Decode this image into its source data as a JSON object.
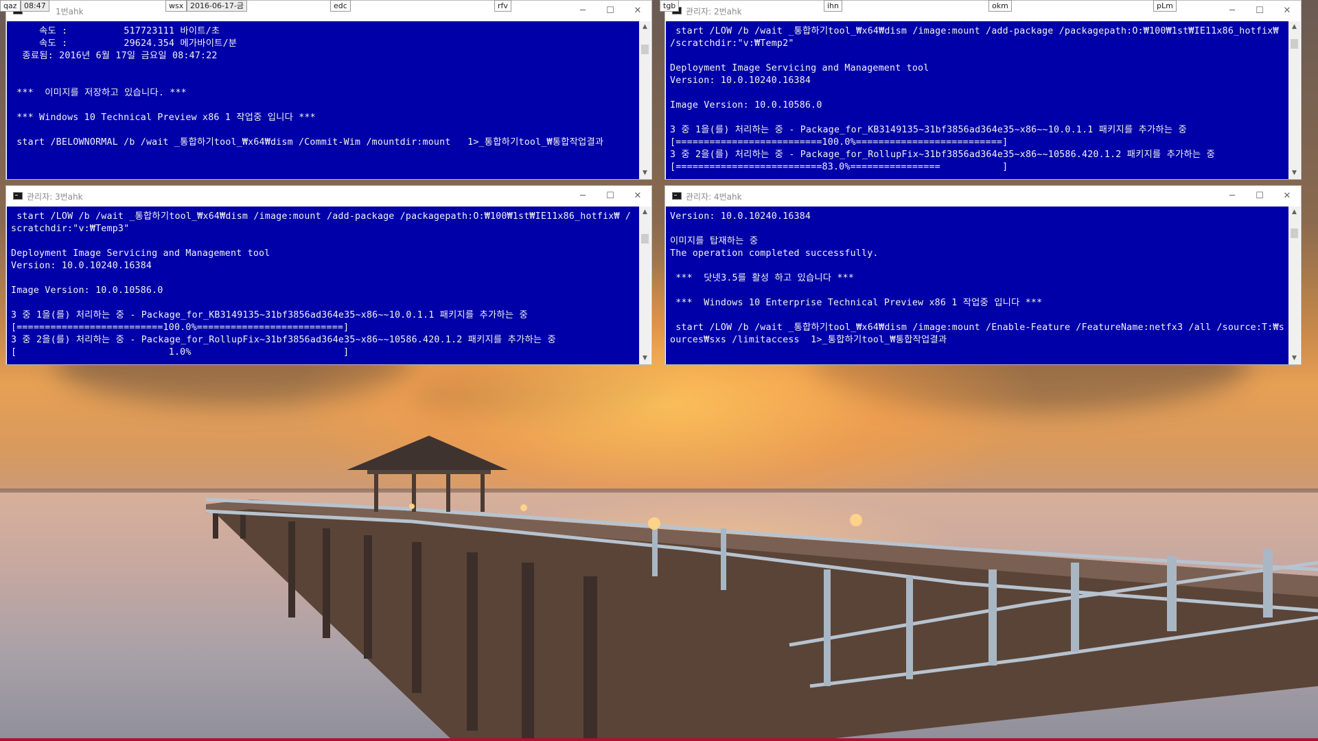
{
  "taskbar": {
    "clock": "08:47",
    "date": "2016-06-17-금",
    "keys": [
      "qaz",
      "wsx",
      "edc",
      "rfv",
      "tgb",
      "ihn",
      "okm",
      "pLm"
    ]
  },
  "windows": [
    {
      "title": "1번ahk",
      "lines": [
        "     속도 :          517723111 바이트/초",
        "     속도 :          29624.354 메가바이트/분",
        "  종료됨: 2016년 6월 17일 금요일 08:47:22",
        "",
        "",
        " ***  이미지를 저장하고 있습니다. ***",
        "",
        " *** Windows 10 Technical Preview x86 1 작업중 입니다 ***",
        "",
        " start /BELOWNORMAL /b /wait _통합하기tool_₩x64₩dism /Commit-Wim /mountdir:mount   1>_통합하기tool_₩통합작업결과"
      ]
    },
    {
      "title": "관리자: 2번ahk",
      "lines": [
        " start /LOW /b /wait _통합하기tool_₩x64₩dism /image:mount /add-package /packagepath:O:₩100₩1st₩IE11x86_hotfix₩ /scratchdir:\"v:₩Temp2\"",
        "",
        "Deployment Image Servicing and Management tool",
        "Version: 10.0.10240.16384",
        "",
        "Image Version: 10.0.10586.0",
        "",
        "3 중 1을(를) 처리하는 중 - Package_for_KB3149135~31bf3856ad364e35~x86~~10.0.1.1 패키지를 추가하는 중",
        "[==========================100.0%==========================]",
        "3 중 2을(를) 처리하는 중 - Package_for_RollupFix~31bf3856ad364e35~x86~~10586.420.1.2 패키지를 추가하는 중",
        "[==========================83.0%================           ]"
      ]
    },
    {
      "title": "관리자: 3번ahk",
      "lines": [
        " start /LOW /b /wait _통합하기tool_₩x64₩dism /image:mount /add-package /packagepath:O:₩100₩1st₩IE11x86_hotfix₩ /scratchdir:\"v:₩Temp3\"",
        "",
        "Deployment Image Servicing and Management tool",
        "Version: 10.0.10240.16384",
        "",
        "Image Version: 10.0.10586.0",
        "",
        "3 중 1을(를) 처리하는 중 - Package_for_KB3149135~31bf3856ad364e35~x86~~10.0.1.1 패키지를 추가하는 중",
        "[==========================100.0%==========================]",
        "3 중 2을(를) 처리하는 중 - Package_for_RollupFix~31bf3856ad364e35~x86~~10586.420.1.2 패키지를 추가하는 중",
        "[                           1.0%                           ]"
      ]
    },
    {
      "title": "관리자: 4번ahk",
      "lines": [
        "Version: 10.0.10240.16384",
        "",
        "이미지를 탑재하는 중",
        "The operation completed successfully.",
        "",
        " ***  닷넷3.5를 활성 하고 있습니다 ***",
        "",
        " ***  Windows 10 Enterprise Technical Preview x86 1 작업중 입니다 ***",
        "",
        " start /LOW /b /wait _통합하기tool_₩x64₩dism /image:mount /Enable-Feature /FeatureName:netfx3 /all /source:T:₩sources₩sxs /limitaccess  1>_통합하기tool_₩통합작업결과"
      ]
    }
  ],
  "window_buttons": {
    "minimize": "─",
    "maximize": "☐",
    "close": "✕"
  },
  "scrollbar": {
    "up": "▲",
    "down": "▼"
  },
  "colors": {
    "console_bg": "#0000a8",
    "console_fg": "#f2f2f2",
    "accent_line": "#b10f2e"
  }
}
